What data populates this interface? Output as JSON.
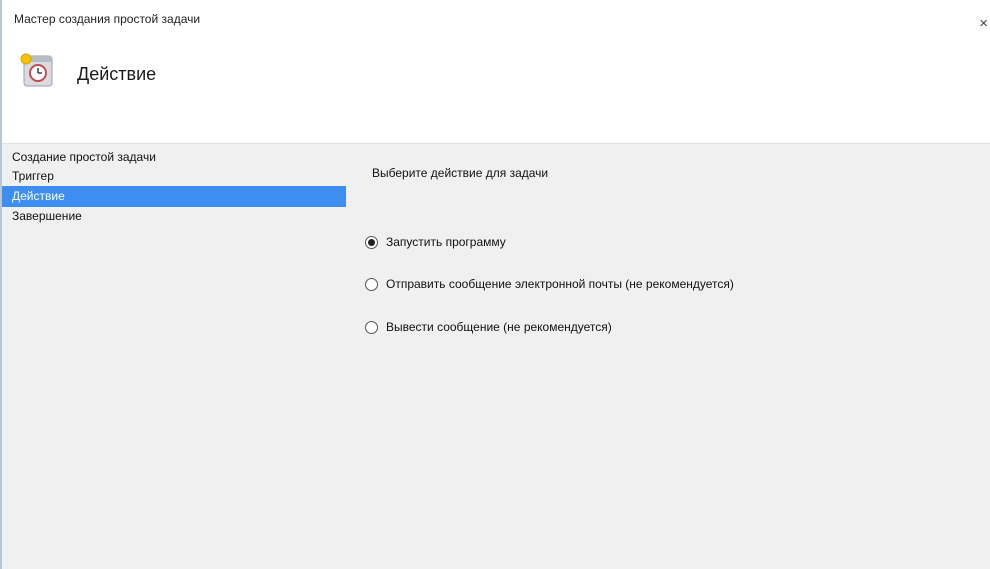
{
  "window": {
    "title": "Мастер создания простой задачи",
    "close_glyph": "×"
  },
  "header": {
    "icon": "task-scheduler-clock-icon",
    "heading": "Действие"
  },
  "sidebar": {
    "steps": [
      {
        "label": "Создание простой задачи",
        "active": false
      },
      {
        "label": "Триггер",
        "active": false
      },
      {
        "label": "Действие",
        "active": true
      },
      {
        "label": "Завершение",
        "active": false
      }
    ]
  },
  "main": {
    "prompt": "Выберите действие для задачи",
    "options": [
      {
        "label": "Запустить программу",
        "selected": true
      },
      {
        "label": "Отправить сообщение электронной почты (не рекомендуется)",
        "selected": false
      },
      {
        "label": "Вывести сообщение (не рекомендуется)",
        "selected": false
      }
    ]
  },
  "colors": {
    "selection": "#3d8ef0",
    "header_bg": "#ffffff",
    "body_bg": "#f0f0f0",
    "border_left": "#b9c6d3"
  }
}
